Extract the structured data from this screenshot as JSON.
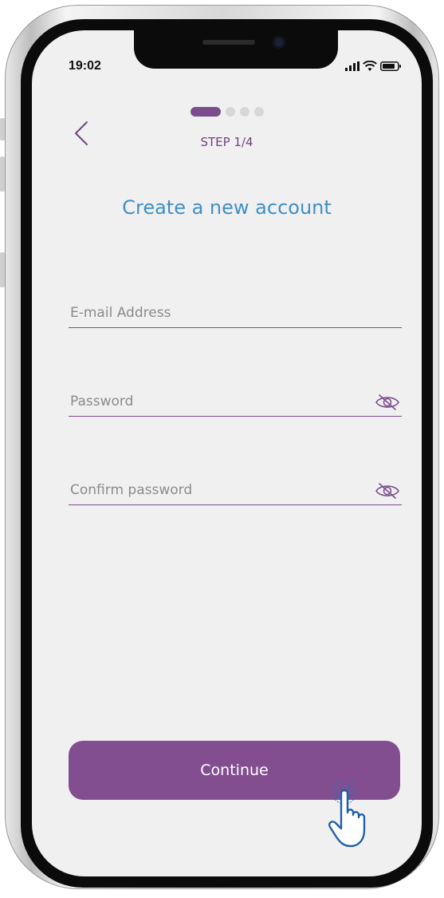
{
  "status_bar": {
    "time": "19:02"
  },
  "header": {
    "back_icon": "chevron-left-icon",
    "step_label": "STEP 1/4",
    "steps_total": 4,
    "steps_current": 1
  },
  "main": {
    "title": "Create a new account",
    "fields": [
      {
        "label": "E-mail Address",
        "has_eye_icon": false
      },
      {
        "label": "Password",
        "has_eye_icon": true
      },
      {
        "label": "Confirm password",
        "has_eye_icon": true
      }
    ],
    "continue_label": "Continue"
  },
  "colors": {
    "accent_purple": "#824e90",
    "title_blue": "#3f8fc5",
    "screen_bg": "#f1f0f1"
  }
}
